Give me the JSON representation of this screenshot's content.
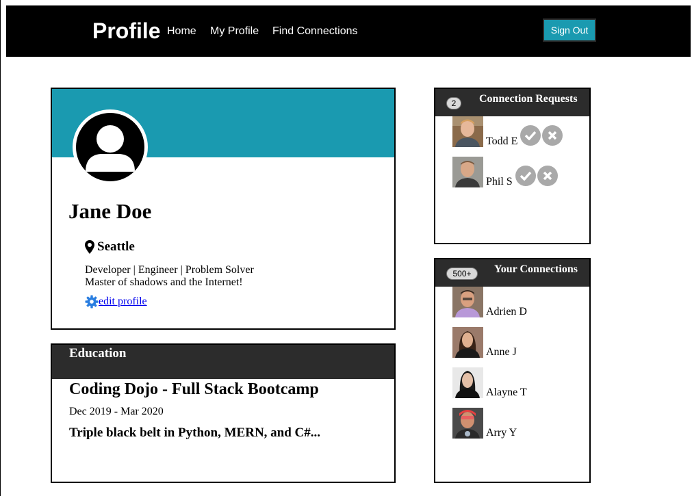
{
  "nav": {
    "brand": "Profile",
    "links": [
      "Home",
      "My Profile",
      "Find Connections"
    ],
    "sign_out": "Sign Out",
    "accent_color": "#1a9ab0"
  },
  "profile": {
    "name": "Jane Doe",
    "location": "Seattle",
    "bio_line1": "Developer | Engineer | Problem Solver",
    "bio_line2": "Master of shadows and the Internet!",
    "edit_label": " edit profile",
    "location_icon": "map-pin-icon",
    "edit_icon": "gear-icon"
  },
  "education": {
    "header": "Education",
    "school": "Coding Dojo - Full Stack Bootcamp",
    "dates": "Dec 2019 - Mar 2020",
    "description": "Triple black belt in Python, MERN, and C#..."
  },
  "requests": {
    "count": "2",
    "title": "Connection Requests",
    "people": [
      {
        "name": "Todd E"
      },
      {
        "name": "Phil S"
      }
    ]
  },
  "connections": {
    "count": "500+",
    "title": "Your Connections",
    "people": [
      {
        "name": "Adrien D"
      },
      {
        "name": "Anne J"
      },
      {
        "name": "Alayne T"
      },
      {
        "name": "Arry Y"
      }
    ]
  }
}
